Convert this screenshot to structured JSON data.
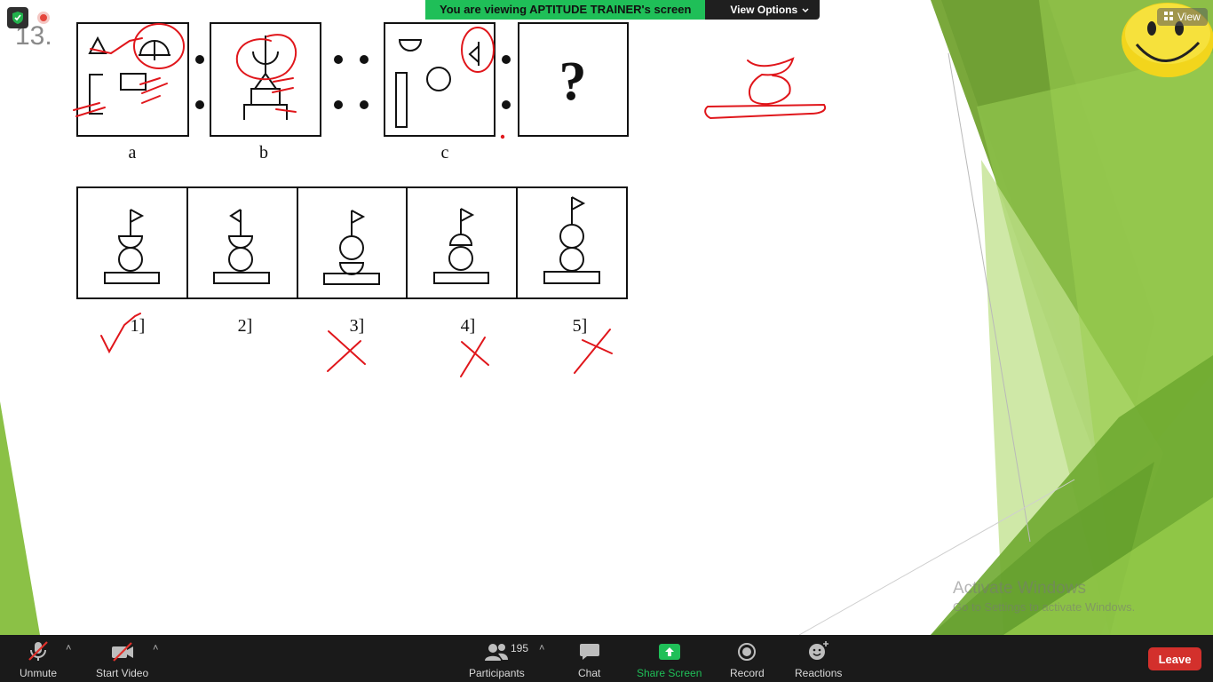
{
  "question_number": "13.",
  "question": {
    "box_labels": [
      "a",
      "b",
      "c"
    ],
    "unknown_mark": "?",
    "option_labels": [
      "1]",
      "2]",
      "3]",
      "4]",
      "5]"
    ]
  },
  "banner": {
    "viewing_text": "You are viewing APTITUDE TRAINER's screen",
    "view_options_label": "View Options"
  },
  "view_button_label": "View",
  "watermark": {
    "title": "Activate Windows",
    "subtitle": "Go to Settings to activate Windows."
  },
  "toolbar": {
    "unmute_label": "Unmute",
    "start_video_label": "Start Video",
    "participants_label": "Participants",
    "participants_count": "195",
    "chat_label": "Chat",
    "share_screen_label": "Share Screen",
    "record_label": "Record",
    "reactions_label": "Reactions",
    "leave_label": "Leave"
  },
  "colors": {
    "annotation": "#e0161b",
    "share_green": "#1fbf58",
    "leave_red": "#d3302c",
    "toolbar_bg": "#1a1a1a",
    "slide_green": "#7fb63a"
  },
  "icons": [
    "shield-check-icon",
    "recording-icon",
    "smiley-icon",
    "view-grid-icon",
    "microphone-muted-icon",
    "video-off-icon",
    "participants-icon",
    "chat-icon",
    "share-screen-icon",
    "record-icon",
    "reactions-icon",
    "chevron-up-icon",
    "chevron-down-icon"
  ]
}
